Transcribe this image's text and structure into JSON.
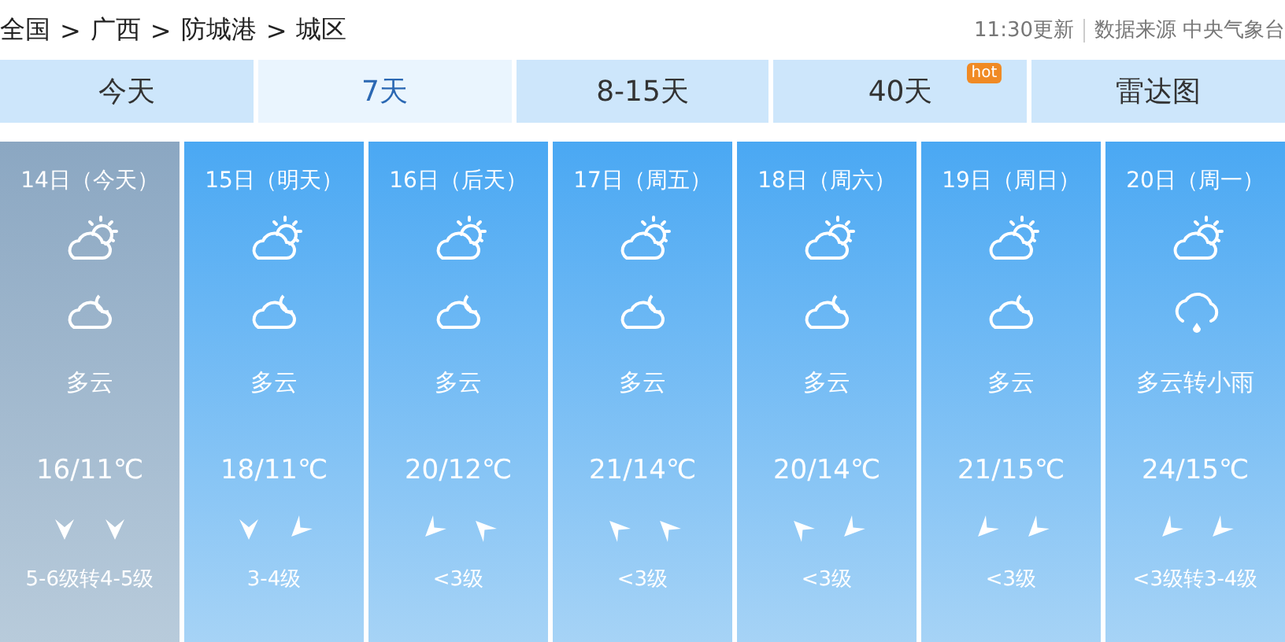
{
  "breadcrumb": [
    "全国",
    "广西",
    "防城港",
    "城区"
  ],
  "breadcrumb_separator": ">",
  "update_time": "11:30更新",
  "source_label": "数据来源",
  "source": "中央气象台",
  "tabs": [
    {
      "label": "今天",
      "selected": false
    },
    {
      "label": "7天",
      "selected": true
    },
    {
      "label": "8-15天",
      "selected": false
    },
    {
      "label": "40天",
      "selected": false,
      "badge": "hot"
    },
    {
      "label": "雷达图",
      "selected": false
    }
  ],
  "days": [
    {
      "date": "14日（今天）",
      "selected": true,
      "weather_icons": [
        {
          "kind": "partly-cloudy-day"
        },
        {
          "kind": "partly-cloudy-night"
        }
      ],
      "weather": "多云",
      "temp": "16/11℃",
      "wind_icons": [
        {
          "kind": "down"
        },
        {
          "kind": "down"
        }
      ],
      "wind": "5-6级转4-5级"
    },
    {
      "date": "15日（明天）",
      "selected": false,
      "weather_icons": [
        {
          "kind": "partly-cloudy-day"
        },
        {
          "kind": "partly-cloudy-night"
        }
      ],
      "weather": "多云",
      "temp": "18/11℃",
      "wind_icons": [
        {
          "kind": "down"
        },
        {
          "kind": "down-left"
        }
      ],
      "wind": "3-4级"
    },
    {
      "date": "16日（后天）",
      "selected": false,
      "weather_icons": [
        {
          "kind": "partly-cloudy-day"
        },
        {
          "kind": "partly-cloudy-night"
        }
      ],
      "weather": "多云",
      "temp": "20/12℃",
      "wind_icons": [
        {
          "kind": "down-left"
        },
        {
          "kind": "up-left"
        }
      ],
      "wind": "<3级"
    },
    {
      "date": "17日（周五）",
      "selected": false,
      "weather_icons": [
        {
          "kind": "partly-cloudy-day"
        },
        {
          "kind": "partly-cloudy-night"
        }
      ],
      "weather": "多云",
      "temp": "21/14℃",
      "wind_icons": [
        {
          "kind": "up-left"
        },
        {
          "kind": "up-left"
        }
      ],
      "wind": "<3级"
    },
    {
      "date": "18日（周六）",
      "selected": false,
      "weather_icons": [
        {
          "kind": "partly-cloudy-day"
        },
        {
          "kind": "partly-cloudy-night"
        }
      ],
      "weather": "多云",
      "temp": "20/14℃",
      "wind_icons": [
        {
          "kind": "up-left"
        },
        {
          "kind": "down-left"
        }
      ],
      "wind": "<3级"
    },
    {
      "date": "19日（周日）",
      "selected": false,
      "weather_icons": [
        {
          "kind": "partly-cloudy-day"
        },
        {
          "kind": "partly-cloudy-night"
        }
      ],
      "weather": "多云",
      "temp": "21/15℃",
      "wind_icons": [
        {
          "kind": "down-left"
        },
        {
          "kind": "down-left"
        }
      ],
      "wind": "<3级"
    },
    {
      "date": "20日（周一）",
      "selected": false,
      "weather_icons": [
        {
          "kind": "partly-cloudy-day"
        },
        {
          "kind": "light-rain"
        }
      ],
      "weather": "多云转小雨",
      "temp": "24/15℃",
      "wind_icons": [
        {
          "kind": "down-left"
        },
        {
          "kind": "down-left"
        }
      ],
      "wind": "<3级转3-4级"
    }
  ]
}
